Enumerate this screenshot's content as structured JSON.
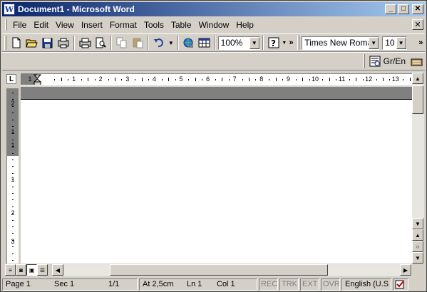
{
  "window": {
    "title": "Document1 - Microsoft Word",
    "app_icon_letter": "W",
    "minimize": "_",
    "maximize": "□",
    "close": "✕"
  },
  "menubar": {
    "items": [
      {
        "label": "File"
      },
      {
        "label": "Edit"
      },
      {
        "label": "View"
      },
      {
        "label": "Insert"
      },
      {
        "label": "Format"
      },
      {
        "label": "Tools"
      },
      {
        "label": "Table"
      },
      {
        "label": "Window"
      },
      {
        "label": "Help"
      }
    ],
    "doc_close": "✕"
  },
  "toolbar": {
    "zoom": "100%",
    "font": "Times New Roman",
    "size": "10",
    "more": "»",
    "lang_toggle": "Gr/En"
  },
  "ruler": {
    "h_numbers": [
      "1",
      "1",
      "2",
      "3",
      "4",
      "5",
      "6",
      "7",
      "8",
      "9",
      "10",
      "11",
      "12",
      "13"
    ],
    "v_numbers": [
      "2",
      "1",
      "1",
      "1",
      "2",
      "3"
    ]
  },
  "statusbar": {
    "page": "Page  1",
    "sec": "Sec  1",
    "pages": "1/1",
    "at": "At  2,5cm",
    "ln": "Ln  1",
    "col": "Col  1",
    "rec": "REC",
    "trk": "TRK",
    "ext": "EXT",
    "ovr": "OVR",
    "language": "English (U.S"
  }
}
